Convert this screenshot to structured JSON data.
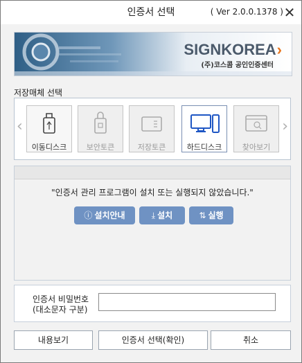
{
  "window": {
    "title": "인증서 선택",
    "version": "( Ver 2.0.0.1378 )",
    "close_glyph": "✕"
  },
  "banner": {
    "logo_text": "SIGNKOREA",
    "logo_arrow": "›",
    "subtitle": "(주)코스콤 공인인증센터"
  },
  "media": {
    "label": "저장매체 선택",
    "prev_glyph": "‹",
    "next_glyph": "›",
    "items": [
      {
        "label": "이동디스크",
        "icon": "usb-icon",
        "state": "enabled"
      },
      {
        "label": "보안토큰",
        "icon": "security-token-icon",
        "state": "disabled"
      },
      {
        "label": "저장토큰",
        "icon": "storage-token-icon",
        "state": "disabled"
      },
      {
        "label": "하드디스크",
        "icon": "hard-disk-icon",
        "state": "selected"
      },
      {
        "label": "찾아보기",
        "icon": "browse-icon",
        "state": "disabled"
      }
    ]
  },
  "status": {
    "message": "\"인증서 관리 프로그램이 설치 또는 실행되지 않았습니다.\"",
    "buttons": [
      {
        "label": "설치안내",
        "glyph": "ⓘ"
      },
      {
        "label": "설치",
        "glyph": "⤓"
      },
      {
        "label": "실행",
        "glyph": "⇅"
      }
    ]
  },
  "password": {
    "label_line1": "인증서 비밀번호",
    "label_line2": "(대소문자 구분)",
    "value": ""
  },
  "footer": {
    "view_label": "내용보기",
    "confirm_label": "인증서 선택(확인)",
    "cancel_label": "취소"
  },
  "colors": {
    "accent": "#6f92c3",
    "logo_arrow": "#e8741c",
    "selected_icon": "#1e56c4"
  }
}
